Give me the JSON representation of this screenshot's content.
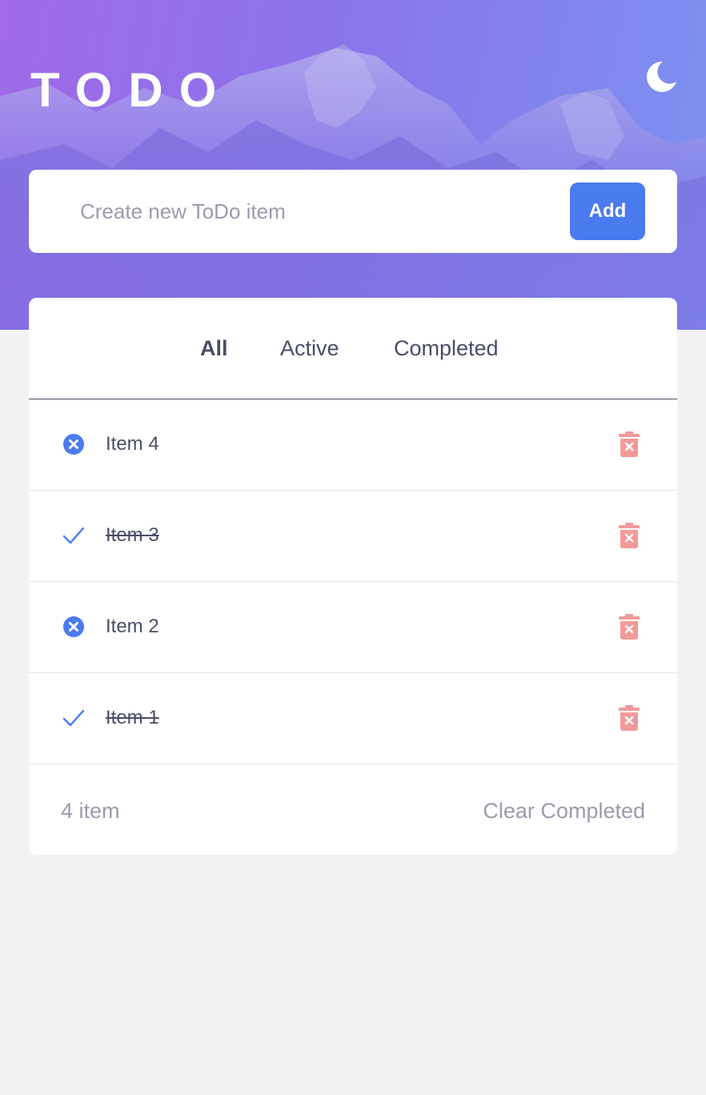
{
  "app": {
    "title": "TODO",
    "theme_icon": "moon-icon"
  },
  "new_item": {
    "placeholder": "Create new ToDo item",
    "value": "",
    "add_label": "Add"
  },
  "filters": [
    {
      "label": "All",
      "selected": true
    },
    {
      "label": "Active",
      "selected": false
    },
    {
      "label": "Completed",
      "selected": false
    }
  ],
  "todos": [
    {
      "label": "Item 4",
      "completed": false,
      "status_icon": "x-circle-icon",
      "delete_icon": "trash-icon"
    },
    {
      "label": "Item 3",
      "completed": true,
      "status_icon": "checkmark-icon",
      "delete_icon": "trash-icon"
    },
    {
      "label": "Item 2",
      "completed": false,
      "status_icon": "x-circle-icon",
      "delete_icon": "trash-icon"
    },
    {
      "label": "Item 1",
      "completed": true,
      "status_icon": "checkmark-icon",
      "delete_icon": "trash-icon"
    }
  ],
  "footer": {
    "count_text": "4 item",
    "clear_label": "Clear Completed"
  },
  "colors": {
    "accent": "#4a7bef",
    "text": "#4a4d68",
    "muted": "#9a9cac",
    "delete": "#f29a9a",
    "background": "#f2f2f2"
  }
}
